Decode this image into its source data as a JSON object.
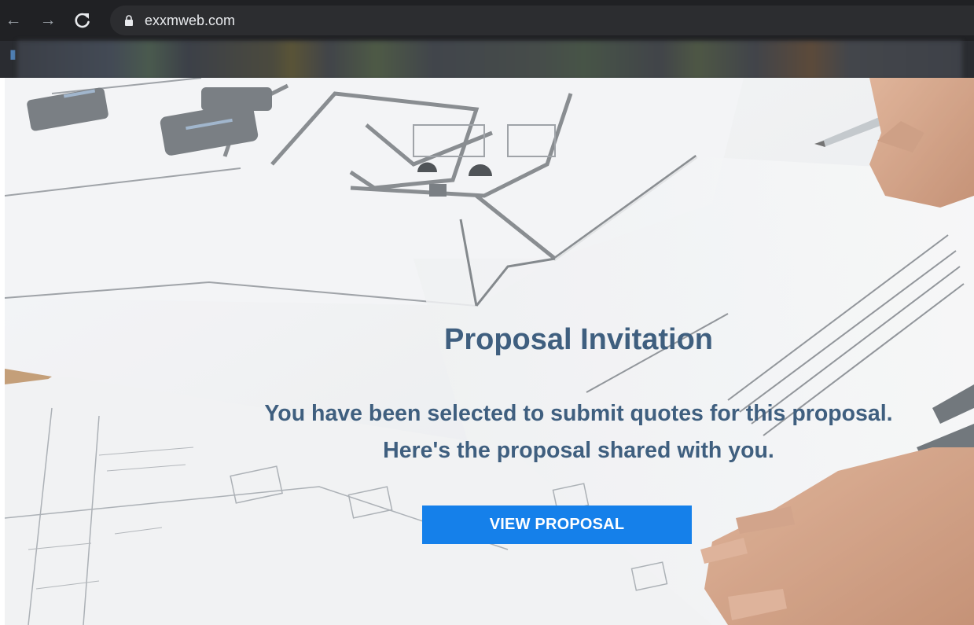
{
  "browser": {
    "url": "exxmweb.com",
    "back_glyph": "←",
    "forward_glyph": "→",
    "reload_glyph": "C",
    "icons": {
      "back": "arrow-left-icon",
      "forward": "arrow-right-icon",
      "reload": "reload-icon",
      "lock": "lock-icon"
    },
    "colors": {
      "toolbar": "#202124",
      "omnibox": "#2c2d30",
      "url_text": "#e8eaed"
    }
  },
  "invitation": {
    "title": "Proposal Invitation",
    "message": "You have been selected to submit quotes for this proposal. Here's the proposal shared with you.",
    "button_label": "VIEW PROPOSAL",
    "colors": {
      "text": "#3f5f7f",
      "button": "#1580ea",
      "button_text": "#ffffff"
    }
  }
}
